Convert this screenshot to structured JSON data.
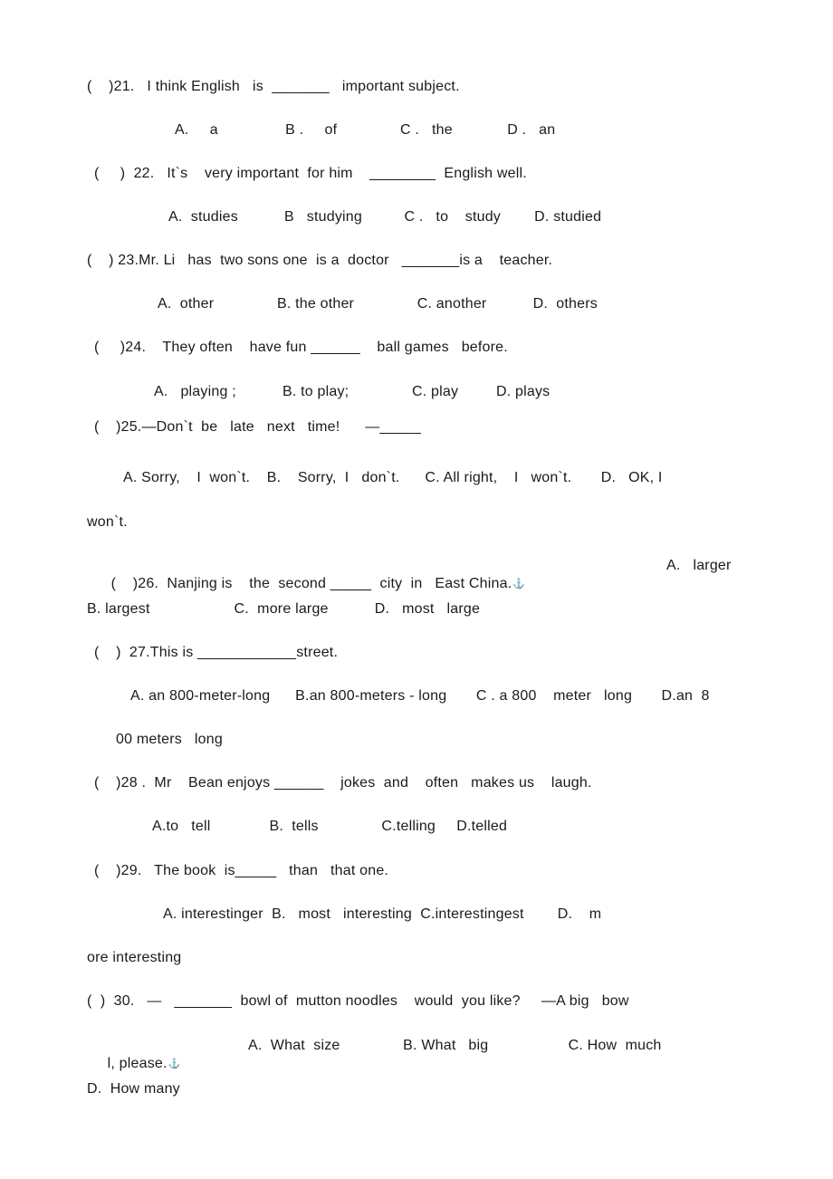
{
  "questions": [
    {
      "number": "21",
      "stem": "(    )21.   I think English   is  _______   important subject.",
      "options_line": "A.     a                B .     of               C .   the             D .   an"
    },
    {
      "number": "22",
      "stem": "(     )  22.   It`s    very important  for him    ________  English well.",
      "options_line": "A.  studies           B   studying          C .   to    study        D. studied"
    },
    {
      "number": "23",
      "stem": "(    ) 23.Mr. Li   has  two sons one  is a  doctor   _______is a    teacher.",
      "options_line": "A.  other               B. the other               C. another           D.  others"
    },
    {
      "number": "24",
      "stem": "(     )24.    They often    have fun ______    ball games   before.",
      "options_line": "A.   playing ;           B. to play;               C. play         D. plays"
    },
    {
      "number": "25",
      "stem": "(    )25.—Don`t  be   late   next   time!      —_____",
      "options_line": "A. Sorry,    I  won`t.    B.    Sorry,  I   don`t.      C. All right,    I   won`t.       D.   OK, I",
      "options_wrap": "won`t."
    },
    {
      "number": "26",
      "stem": "(    )26.  Nanjing is    the  second _____  city  in   East China.",
      "stem_anchor": "anchor",
      "stem_tail": "A.   larger",
      "options_line": "B. largest                    C.  more large           D.   most   large"
    },
    {
      "number": "27",
      "stem": "(    )  27.This is ____________street.",
      "options_line": "A. an 800-meter-long      B.an 800-meters - long       C . a 800    meter   long       D.an  8",
      "options_wrap": "00 meters   long"
    },
    {
      "number": "28",
      "stem": "(    )28 .  Mr    Bean enjoys ______    jokes  and    often   makes us    laugh.",
      "options_line": "A.to   tell              B.  tells               C.telling     D.telled"
    },
    {
      "number": "29",
      "stem": "(    )29.   The book  is_____   than   that one.",
      "options_line": "A. interestinger  B.   most   interesting  C.interestingest        D.    m",
      "options_wrap": "ore interesting"
    },
    {
      "number": "30",
      "stem": "(  )  30.   —   _______  bowl of  mutton noodles    would  you like?     —A big   bow",
      "stem_wrap": "l, please.",
      "stem_wrap_tail": "A.  What  size               B. What   big                   C. How  much",
      "options_wrap": "D.  How many"
    }
  ],
  "anchor_glyph": "⚓"
}
